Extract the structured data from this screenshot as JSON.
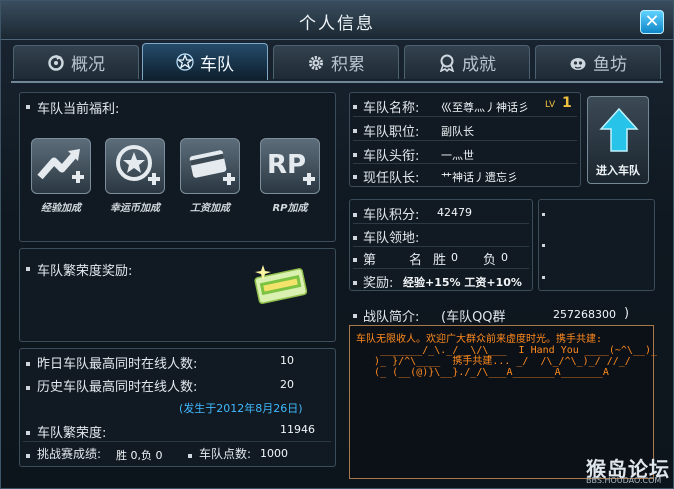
{
  "window": {
    "title": "个人信息",
    "close_label": "✕"
  },
  "tabs": [
    {
      "label": "概况",
      "icon": "refresh-icon"
    },
    {
      "label": "车队",
      "icon": "star-icon"
    },
    {
      "label": "积累",
      "icon": "gear-icon"
    },
    {
      "label": "成就",
      "icon": "medal-icon"
    },
    {
      "label": "鱼坊",
      "icon": "fish-icon"
    }
  ],
  "benefits": {
    "heading": "车队当前福利:",
    "items": [
      {
        "label": "经验加成",
        "icon": "experience-bonus-icon"
      },
      {
        "label": "幸运币加成",
        "icon": "lucky-coin-bonus-icon"
      },
      {
        "label": "工资加成",
        "icon": "salary-bonus-icon"
      },
      {
        "label": "RP加成",
        "icon": "rp-bonus-icon"
      }
    ]
  },
  "prosperity_reward": {
    "heading": "车队繁荣度奖励:",
    "icon": "reward-ticket-icon"
  },
  "stats": {
    "yesterday_label": "昨日车队最高同时在线人数:",
    "yesterday_value": "10",
    "history_label": "历史车队最高同时在线人数:",
    "history_value": "20",
    "history_date": "(发生于2012年8月26日)",
    "prosperity_label": "车队繁荣度:",
    "prosperity_value": "11946",
    "challenge_label": "挑战赛成绩:",
    "challenge_value": "胜 0,负 0",
    "points_label": "车队点数:",
    "points_value": "1000"
  },
  "team": {
    "name_label": "车队名称:",
    "name_value": "巛至尊灬丿神话彡",
    "level_prefix": "LV",
    "level": "1",
    "position_label": "车队职位:",
    "position_value": "副队长",
    "title_label": "车队头衔:",
    "title_value": "一灬世",
    "captain_label": "现任队长:",
    "captain_value": "艹神话丿遗忘彡"
  },
  "join_button": {
    "label": "进入车队",
    "icon": "arrow-up-icon"
  },
  "score": {
    "points_label": "车队积分:",
    "points_value": "42479",
    "territory_label": "车队领地:",
    "rank_prefix": "第",
    "rank_name": "名",
    "wins_label": "胜",
    "wins_value": "0",
    "losses_label": "负",
    "losses_value": "0",
    "reward_label": "奖励:",
    "reward_value": "经验+15% 工资+10%"
  },
  "intro": {
    "heading": "战队简介:",
    "qq_label": "(车队QQ群",
    "qq_value": "257268300",
    "qq_close": ")",
    "text": "车队无限收人。欢迎广大群众前来虚度时光。携手共建:\n    _______/_\\._/__\\/\\___  I Hand You ____(~^\\__)_\n   )_ }/^\\____  携手共建... _/  /\\_/^\\_)_/ //_/\n   (_ (__(@)}\\__}./_/\\___A_______A_______A"
  },
  "watermark": {
    "main": "猴岛论坛",
    "sub": "BBS.HOUDAO.COM"
  },
  "colors": {
    "accent": "#1aa3e0",
    "intro_text": "#ff8a1e",
    "level": "#f0c040"
  }
}
